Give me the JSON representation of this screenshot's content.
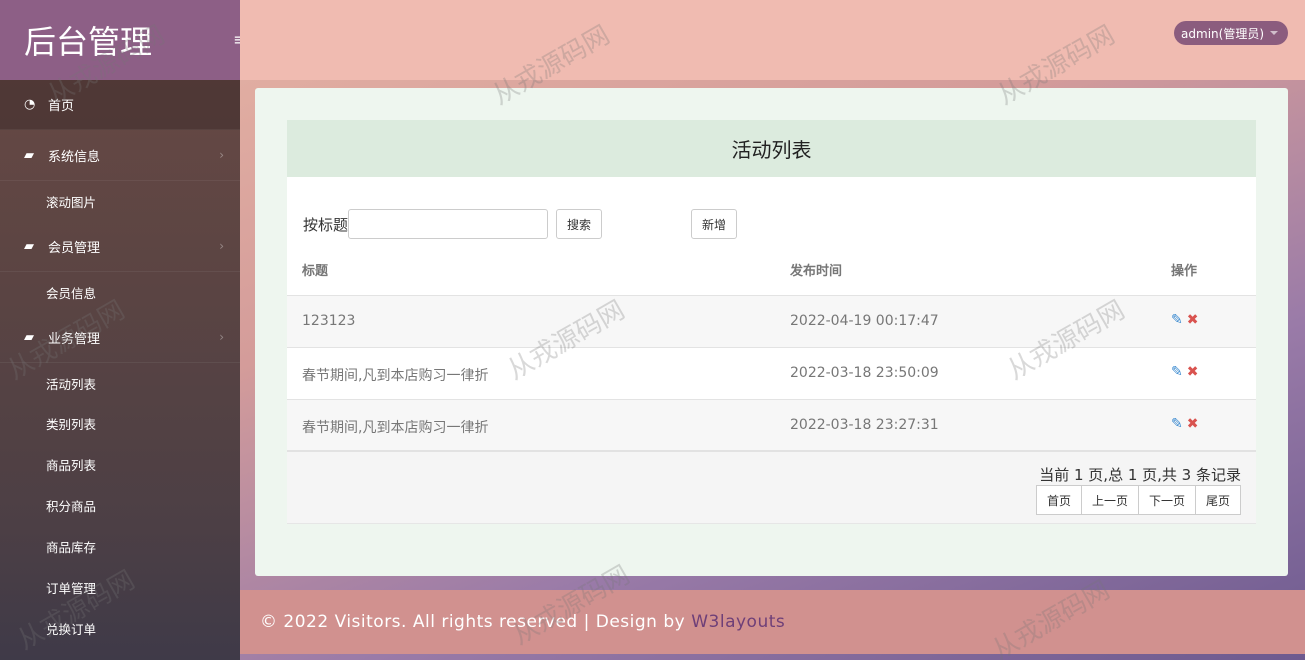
{
  "sidebar": {
    "brand": "后台管理",
    "toggle_icon": "≡",
    "home": "首页",
    "groups": [
      {
        "label": "系统信息",
        "items": [
          "滚动图片"
        ]
      },
      {
        "label": "会员管理",
        "items": [
          "会员信息"
        ]
      },
      {
        "label": "业务管理",
        "items": [
          "活动列表",
          "类别列表",
          "商品列表",
          "积分商品",
          "商品库存",
          "订单管理",
          "兑换订单"
        ]
      }
    ]
  },
  "header": {
    "user": "admin(管理员)"
  },
  "panel": {
    "title": "活动列表",
    "search_label": "按标题",
    "search_value": "",
    "search_button": "搜索",
    "add_button": "新增",
    "columns": [
      "标题",
      "发布时间",
      "操作"
    ],
    "rows": [
      {
        "title": "123123",
        "time": "2022-04-19 00:17:47"
      },
      {
        "title": "春节期间,凡到本店购习一律折",
        "time": "2022-03-18 23:50:09"
      },
      {
        "title": "春节期间,凡到本店购习一律折",
        "time": "2022-03-18 23:27:31"
      }
    ],
    "pager": {
      "info": "当前 1 页,总 1 页,共 3 条记录",
      "first": "首页",
      "prev": "上一页",
      "next": "下一页",
      "last": "尾页"
    }
  },
  "footer": {
    "text": "© 2022 Visitors. All rights reserved | Design by",
    "link": "W3layouts"
  },
  "watermark": "从戎源码网",
  "colors": {
    "brand": "#8d5f86",
    "topbar": "#f0bbb1",
    "footer": "#d1918f",
    "panel_head": "#dcebde",
    "edit": "#3a8ad0",
    "delete": "#d9534f"
  }
}
